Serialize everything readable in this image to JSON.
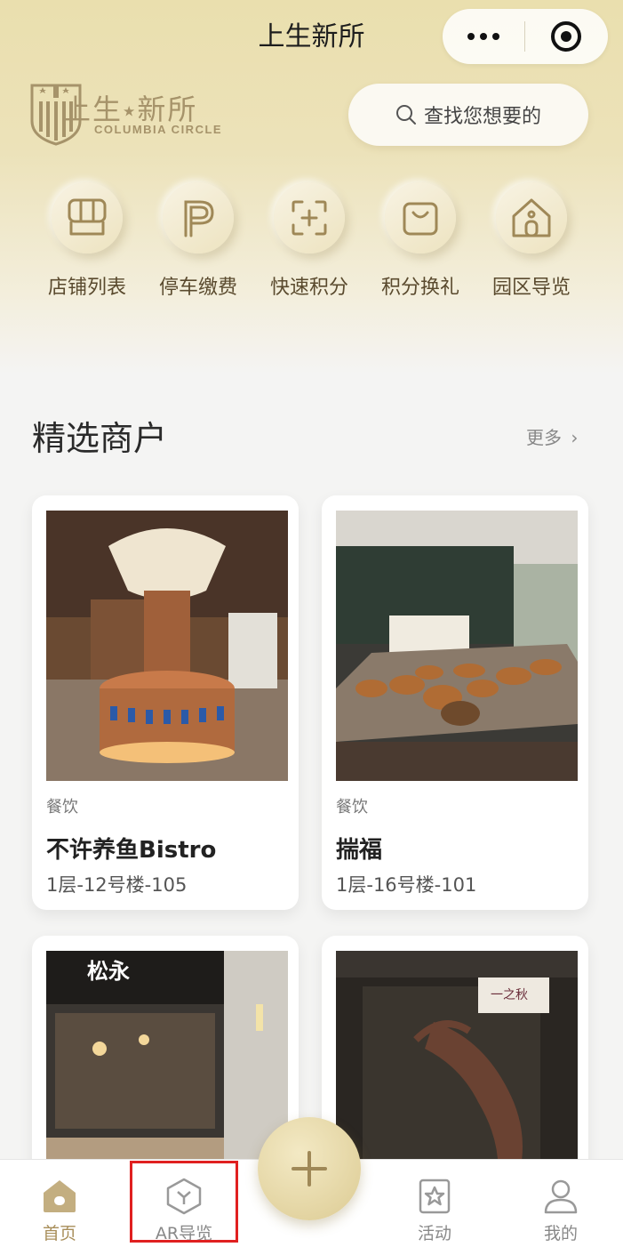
{
  "app": {
    "title": "上生新所"
  },
  "brand": {
    "name_cn": "上生",
    "name_cn_2": "新所",
    "name_en": "COLUMBIA CIRCLE"
  },
  "search": {
    "placeholder": "查找您想要的"
  },
  "quick_actions": [
    {
      "label": "店铺列表",
      "icon": "store-list-icon"
    },
    {
      "label": "停车缴费",
      "icon": "parking-icon"
    },
    {
      "label": "快速积分",
      "icon": "quick-points-icon"
    },
    {
      "label": "积分换礼",
      "icon": "gift-bag-icon"
    },
    {
      "label": "园区导览",
      "icon": "park-guide-icon"
    }
  ],
  "section": {
    "title": "精选商户",
    "more": "更多"
  },
  "merchants": [
    {
      "category": "餐饮",
      "name": "不许养鱼Bistro",
      "location": "1层-12号楼-105"
    },
    {
      "category": "餐饮",
      "name": "揣福",
      "location": "1层-16号楼-101"
    },
    {
      "sign": "松永"
    },
    {
      "sign": "一之秋"
    }
  ],
  "tabbar": {
    "items": [
      {
        "label": "首页",
        "icon": "home-icon",
        "active": true
      },
      {
        "label": "AR导览",
        "icon": "ar-guide-icon",
        "active": false
      },
      {
        "label": "活动",
        "icon": "activity-icon",
        "active": false
      },
      {
        "label": "我的",
        "icon": "profile-icon",
        "active": false
      }
    ],
    "center_icon": "plus-icon"
  },
  "colors": {
    "accent": "#a88e5a",
    "gold_light": "#eadfae",
    "highlight": "#e02020"
  }
}
